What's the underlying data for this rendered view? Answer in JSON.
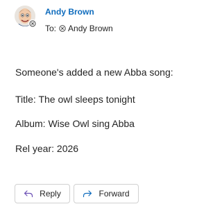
{
  "message": {
    "sender_name": "Andy Brown",
    "to_label": "To:",
    "recipient": "Andy Brown",
    "body": {
      "intro": "Someone's added a new Abba song:",
      "title_line": "Title: The owl sleeps tonight",
      "album_line": "Album: Wise Owl sing Abba",
      "year_line": "Rel year: 2026"
    }
  },
  "actions": {
    "reply_label": "Reply",
    "forward_label": "Forward"
  },
  "colors": {
    "sender_name": "#0f6cbd",
    "text": "#242424",
    "button_border": "#d1d1d1",
    "reply_icon": "#6b4fb5",
    "forward_icon": "#0f6cbd"
  }
}
